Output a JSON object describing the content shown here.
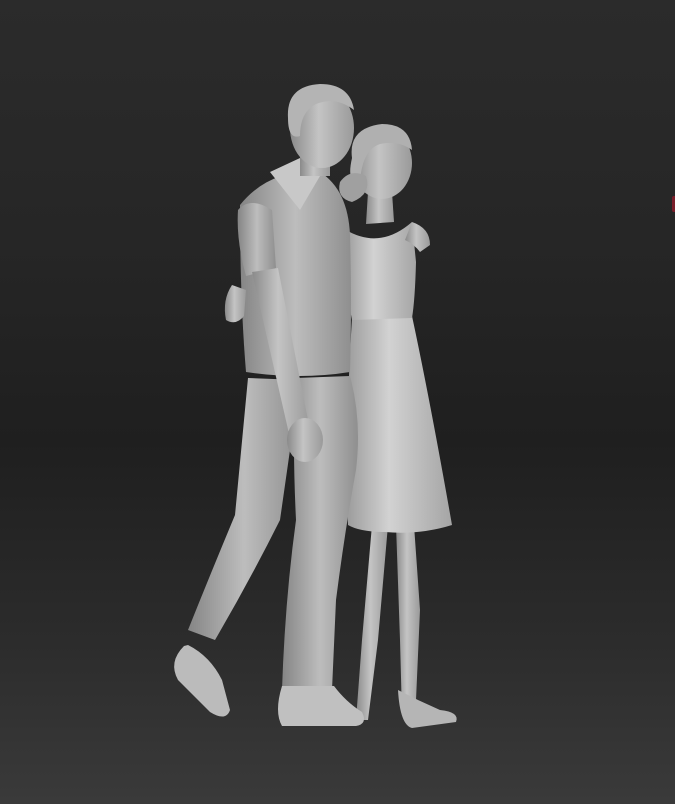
{
  "viewport": {
    "subject": "3d-sculpt-couple-walking",
    "background_colors": [
      "#2b2b2b",
      "#1f1f1f",
      "#3a3a3a"
    ],
    "model_color": "#a9a9a9",
    "edge_marker_color": "#7a1e2a"
  }
}
